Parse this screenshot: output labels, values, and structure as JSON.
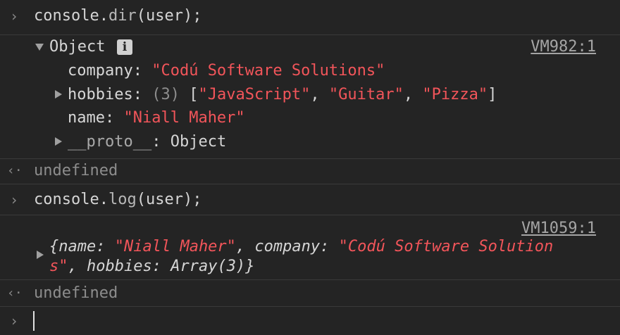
{
  "prompt_symbol": "›",
  "return_symbol": "‹·",
  "command1": {
    "prefix": "console.",
    "fn": "dir",
    "suffix": "(user);"
  },
  "dir_output": {
    "label": "Object",
    "info_glyph": "i",
    "source": "VM982:1",
    "props": {
      "company_key": "company:",
      "company_val": "\"Codú Software Solutions\"",
      "hobbies_key": "hobbies:",
      "hobbies_count": "(3)",
      "hobbies_open": "[",
      "hobbies_items": [
        "\"JavaScript\"",
        "\"Guitar\"",
        "\"Pizza\""
      ],
      "hobbies_sep": ", ",
      "hobbies_close": "]",
      "name_key": "name:",
      "name_val": "\"Niall Maher\"",
      "proto_key": "__proto__",
      "proto_colon": ":",
      "proto_val": "Object"
    }
  },
  "result1": "undefined",
  "command2": {
    "prefix": "console.",
    "fn": "log",
    "suffix": "(user);"
  },
  "log_output": {
    "source": "VM1059:1",
    "open": "{",
    "name_key": "name:",
    "name_val": "\"Niall Maher\"",
    "sep": ", ",
    "company_key": "company:",
    "company_val_line1": "\"Codú Software Solution",
    "company_val_line2": "s\"",
    "hobbies_key": "hobbies:",
    "hobbies_val": "Array(3)",
    "close": "}"
  },
  "result2": "undefined"
}
